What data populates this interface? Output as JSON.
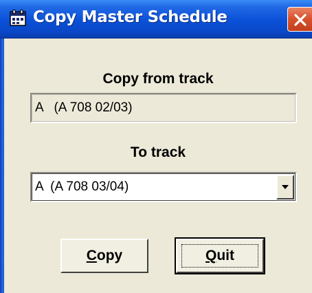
{
  "window": {
    "title": "Copy Master Schedule",
    "icon": "app-schedule-icon",
    "close_icon": "close-icon",
    "colors": {
      "titlebar": "#0a50d8",
      "close_button": "#d8542f",
      "body": "#ece9d8"
    }
  },
  "form": {
    "from_label": "Copy from track",
    "from_value": "A   (A 708 02/03)",
    "to_label": "To track",
    "to_value": "A  (A 708 03/04)"
  },
  "buttons": {
    "copy": {
      "accel": "C",
      "rest": "opy"
    },
    "quit": {
      "accel": "Q",
      "rest": "uit"
    }
  }
}
